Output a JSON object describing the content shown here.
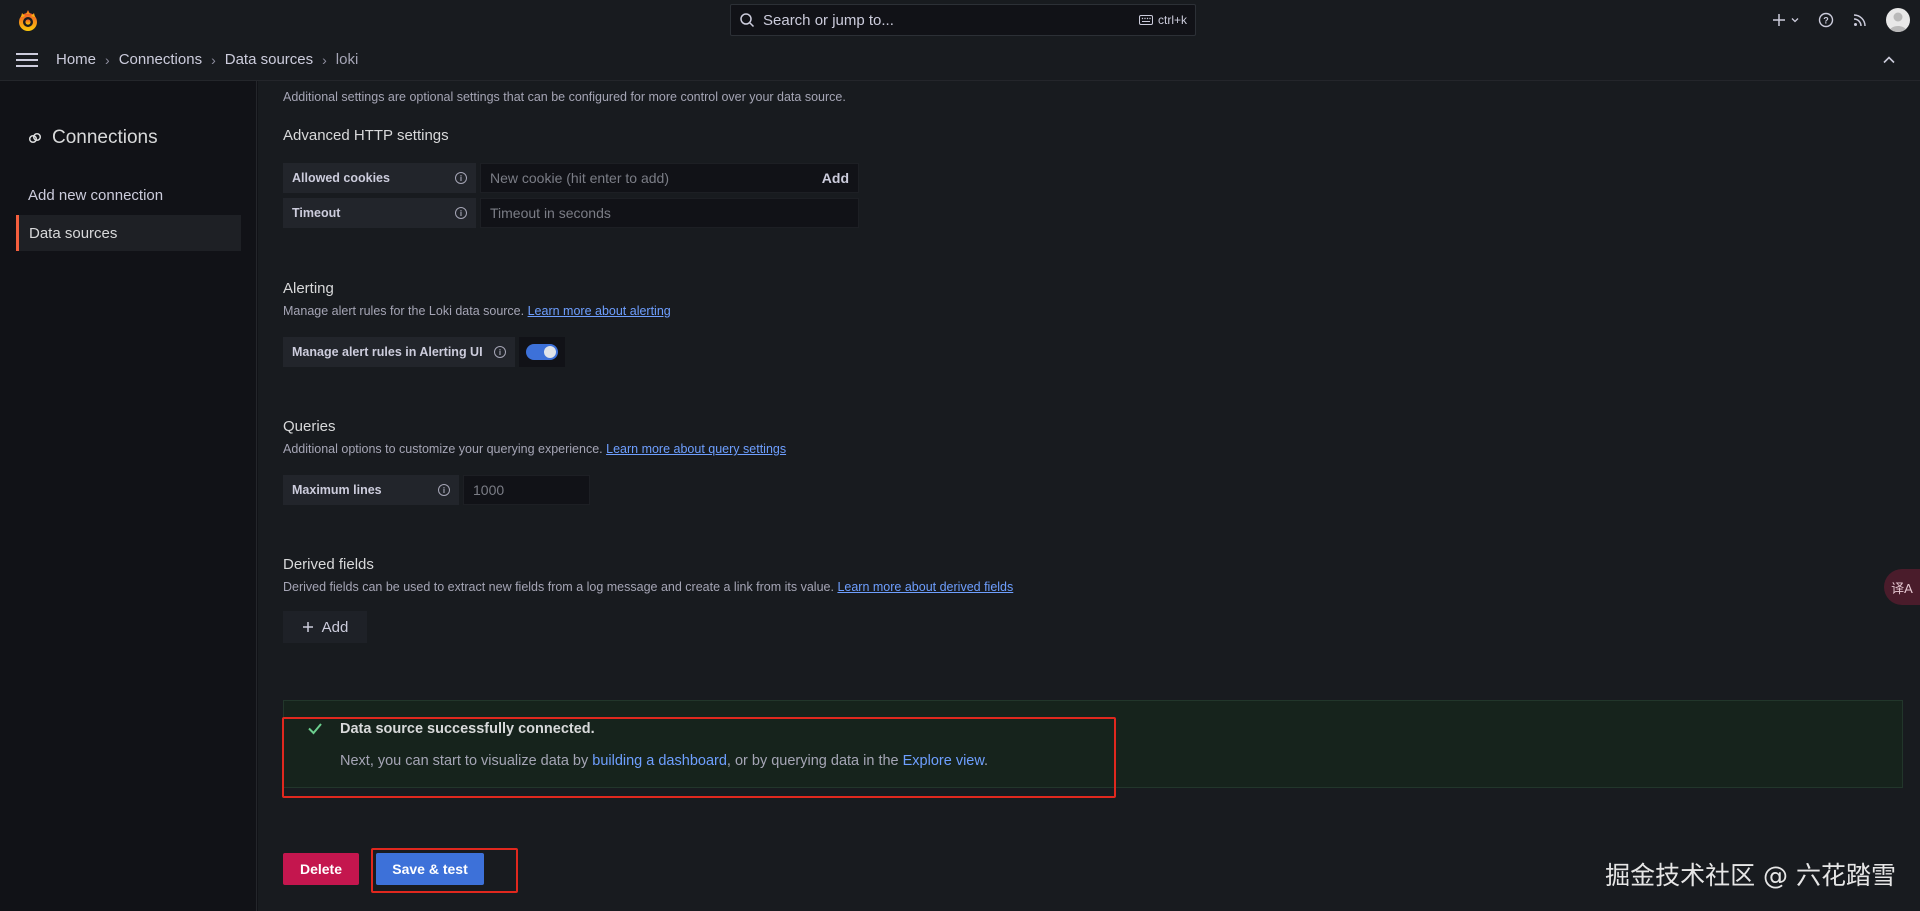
{
  "topbar": {
    "search_placeholder": "Search or jump to...",
    "shortcut": "ctrl+k"
  },
  "breadcrumb": {
    "items": [
      "Home",
      "Connections",
      "Data sources",
      "loki"
    ]
  },
  "sidebar": {
    "title": "Connections",
    "items": [
      {
        "label": "Add new connection",
        "active": false
      },
      {
        "label": "Data sources",
        "active": true
      }
    ]
  },
  "additional_settings": {
    "description": "Additional settings are optional settings that can be configured for more control over your data source."
  },
  "http": {
    "heading": "Advanced HTTP settings",
    "allowed_cookies_label": "Allowed cookies",
    "allowed_cookies_placeholder": "New cookie (hit enter to add)",
    "add_label": "Add",
    "timeout_label": "Timeout",
    "timeout_placeholder": "Timeout in seconds"
  },
  "alerting": {
    "heading": "Alerting",
    "description": "Manage alert rules for the Loki data source.",
    "link": "Learn more about alerting",
    "toggle_label": "Manage alert rules in Alerting UI",
    "toggle_on": true
  },
  "queries": {
    "heading": "Queries",
    "description": "Additional options to customize your querying experience.",
    "link": "Learn more about query settings",
    "max_lines_label": "Maximum lines",
    "max_lines_placeholder": "1000"
  },
  "derived": {
    "heading": "Derived fields",
    "description": "Derived fields can be used to extract new fields from a log message and create a link from its value.",
    "link": "Learn more about derived fields",
    "add_label": "Add"
  },
  "alert": {
    "title": "Data source successfully connected.",
    "body_prefix": "Next, you can start to visualize data by ",
    "link1": "building a dashboard",
    "body_mid": ", or by querying data in the ",
    "link2": "Explore view",
    "body_suffix": "."
  },
  "actions": {
    "delete": "Delete",
    "save": "Save & test"
  },
  "overlay": {
    "translate_icon_text": "译A",
    "watermark": "掘金技术社区 @ 六花踏雪"
  },
  "colors": {
    "primary": "#3d71d9",
    "danger": "#c4164e",
    "success_bg": "#16231c",
    "highlight_frame": "#e0281e",
    "brand": "#f55f3e"
  }
}
